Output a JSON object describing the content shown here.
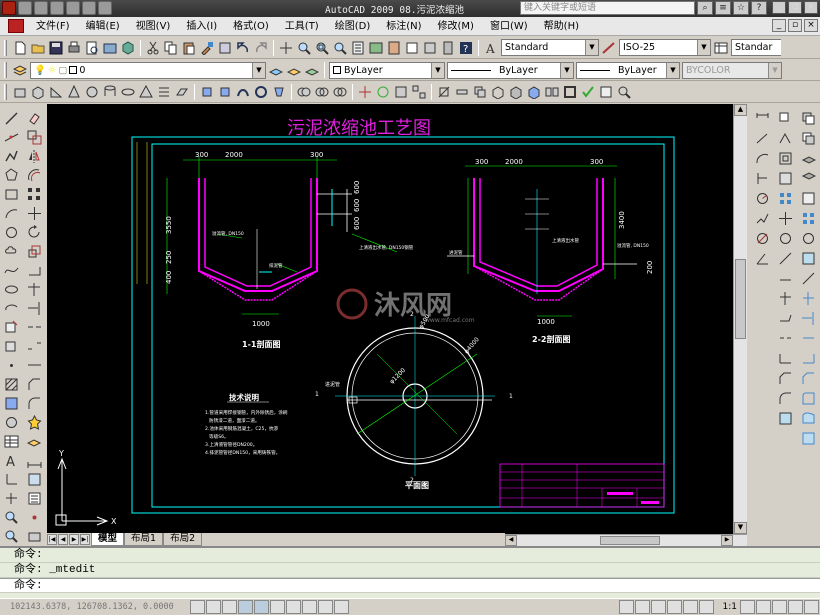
{
  "app": {
    "title": "AutoCAD 2009  08.污泥浓缩池",
    "search_placeholder": "键入关键字或短语"
  },
  "menu": [
    "文件(F)",
    "编辑(E)",
    "视图(V)",
    "插入(I)",
    "格式(O)",
    "工具(T)",
    "绘图(D)",
    "标注(N)",
    "修改(M)",
    "窗口(W)",
    "帮助(H)"
  ],
  "styles_toolbar": {
    "text_style": "Standard",
    "dim_style": "ISO-25",
    "table_style": "Standar"
  },
  "layers_toolbar": {
    "layer": "0",
    "color": "ByLayer",
    "linetype": "ByLayer",
    "lineweight": "ByLayer",
    "plotstyle": "BYCOLOR"
  },
  "drawing": {
    "title": "污泥浓缩池工艺图",
    "section1_label": "1-1剖面图",
    "section2_label": "2-2剖面图",
    "plan_label": "平面图",
    "notes_title": "技术说明",
    "notes": [
      "1.管道采用焊接钢管，内外除锈后，涂刷",
      "防锈漆二道，面漆二道。",
      "2.池体采用钢筋混凝土，C25，抗渗",
      "等级S6。",
      "3.上清液管管径DN200。",
      "4.排泥管管径DN150，采用铸铁管。"
    ],
    "dims": {
      "d300a": "300",
      "d2000a": "2000",
      "d300b": "300",
      "d300c": "300",
      "d2000b": "2000",
      "d300d": "300",
      "h3550": "3550",
      "h3400": "3400",
      "h250": "250",
      "h400": "400",
      "h600a": "600",
      "h600b": "600",
      "h600c": "600",
      "h200": "200",
      "b1000a": "1000",
      "b1000b": "1000"
    },
    "pipe_labels": {
      "overflow": "溢流管, DN150",
      "supernatant": "上清液出水管, DN150钢管",
      "sludge": "排泥管",
      "supernatant2": "上清液出水管",
      "overflow2": "溢流管, DN150",
      "inlet": "进泥管",
      "inlet2": "进泥管"
    },
    "plan_dims": {
      "r1": "φ1200",
      "r2": "φ4000",
      "r3": "φ500"
    },
    "section_marks": {
      "s1": "1",
      "s1b": "1",
      "s2": "2",
      "s2b": "2"
    },
    "watermark": "沐风网",
    "watermark_url": "www.mfcad.com"
  },
  "tabs": [
    "模型",
    "布局1",
    "布局2"
  ],
  "commands": [
    "命令:",
    "命令: _mtedit",
    "命令:"
  ],
  "status": {
    "coords": "102143.6378, 126708.1362, 0.0000",
    "scale": "1:1"
  },
  "colors": {
    "bg": "#000000",
    "border": "#00ffff",
    "section": "#ff00ff",
    "dim": "#00ff00",
    "title": "#e020e0"
  }
}
